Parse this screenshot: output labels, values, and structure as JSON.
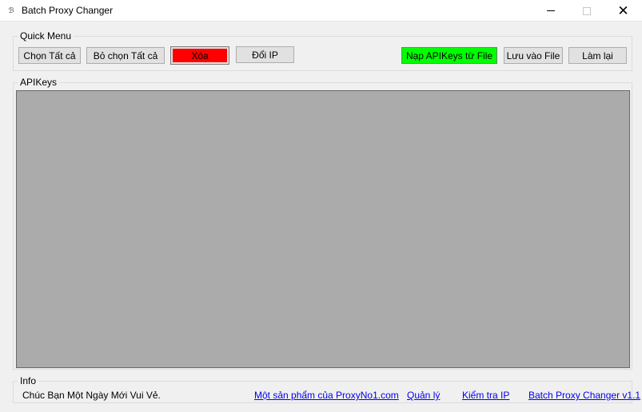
{
  "window": {
    "title": "Batch Proxy Changer",
    "icon": "app-icon",
    "close_glyph": "✕"
  },
  "quick_menu": {
    "title": "Quick Menu",
    "buttons": {
      "select_all": "Chọn Tất cả",
      "deselect_all": "Bỏ chọn Tất cả",
      "delete": "Xóa",
      "change_ip": "Đổi IP",
      "load_apikeys": "Nạp APIKeys từ File",
      "save_file": "Lưu vào File",
      "reset": "Làm lại"
    },
    "colors": {
      "delete_bg": "#ff0000",
      "load_bg": "#00ff00"
    }
  },
  "apikeys": {
    "title": "APIKeys"
  },
  "info": {
    "title": "Info",
    "greeting": "Chúc Bạn Một Ngày Mới Vui Vẻ.",
    "product_link": "Một sản phẩm của ProxyNo1.com",
    "manage_link": "Quản lý",
    "check_ip_link": "Kiểm tra IP",
    "version_link": "Batch Proxy Changer v1.1"
  }
}
